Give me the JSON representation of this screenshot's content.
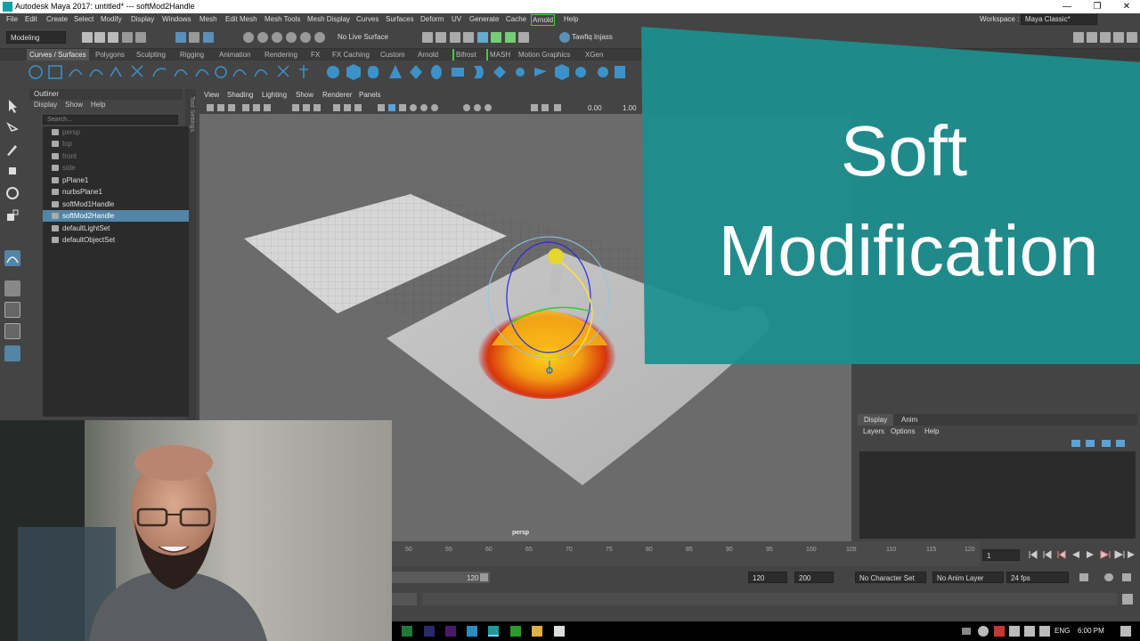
{
  "window": {
    "title": "Autodesk Maya 2017: untitled*   ---   softMod2Handle",
    "controls": [
      "—",
      "❐",
      "✕"
    ]
  },
  "menubar": {
    "items": [
      "File",
      "Edit",
      "Create",
      "Select",
      "Modify",
      "Display",
      "Windows",
      "Mesh",
      "Edit Mesh",
      "Mesh Tools",
      "Mesh Display",
      "Curves",
      "Surfaces",
      "Deform",
      "UV",
      "Generate",
      "Cache",
      "Arnold",
      "Help"
    ],
    "workspace_label": "Workspace :",
    "workspace_value": "Maya Classic*"
  },
  "toolbar": {
    "mode": "Modeling",
    "live_surface": "No Live Surface",
    "user": "Tawfiq Injass"
  },
  "shelf": {
    "tabs": [
      "Curves / Surfaces",
      "Polygons",
      "Sculpting",
      "Rigging",
      "Animation",
      "Rendering",
      "FX",
      "FX Caching",
      "Custom",
      "Arnold",
      "Bifrost",
      "MASH",
      "Motion Graphics",
      "XGen"
    ]
  },
  "outliner": {
    "title": "Outliner",
    "menu": [
      "Display",
      "Show",
      "Help"
    ],
    "search_placeholder": "Search...",
    "items": [
      {
        "label": "persp",
        "state": "dim"
      },
      {
        "label": "top",
        "state": "dim"
      },
      {
        "label": "front",
        "state": "dim"
      },
      {
        "label": "side",
        "state": "dim"
      },
      {
        "label": "pPlane1",
        "state": "normal"
      },
      {
        "label": "nurbsPlane1",
        "state": "normal"
      },
      {
        "label": "softMod1Handle",
        "state": "normal"
      },
      {
        "label": "softMod2Handle",
        "state": "selected"
      },
      {
        "label": "defaultLightSet",
        "state": "normal"
      },
      {
        "label": "defaultObjectSet",
        "state": "normal"
      }
    ]
  },
  "tool_settings_label": "Tool Settings",
  "viewport": {
    "menu": [
      "View",
      "Shading",
      "Lighting",
      "Show",
      "Renderer",
      "Panels"
    ],
    "field1": "0.00",
    "field2": "1.00",
    "camera_label": "persp"
  },
  "overlay": {
    "line1": "Soft",
    "line2": "Modification",
    "color": "#1d8f8f"
  },
  "layers": {
    "tabs": [
      "Display",
      "Anim"
    ],
    "menu": [
      "Layers",
      "Options",
      "Help"
    ]
  },
  "timeline": {
    "ticks": [
      "50",
      "55",
      "60",
      "65",
      "70",
      "75",
      "80",
      "85",
      "90",
      "95",
      "100",
      "105",
      "110",
      "115",
      "120"
    ],
    "current_frame": "1"
  },
  "range": {
    "slider_end": "120",
    "end": "120",
    "max": "200",
    "character_set": "No Character Set",
    "anim_layer": "No Anim Layer",
    "fps": "24 fps"
  },
  "taskbar": {
    "lang": "ENG",
    "time": "6:00 PM"
  }
}
